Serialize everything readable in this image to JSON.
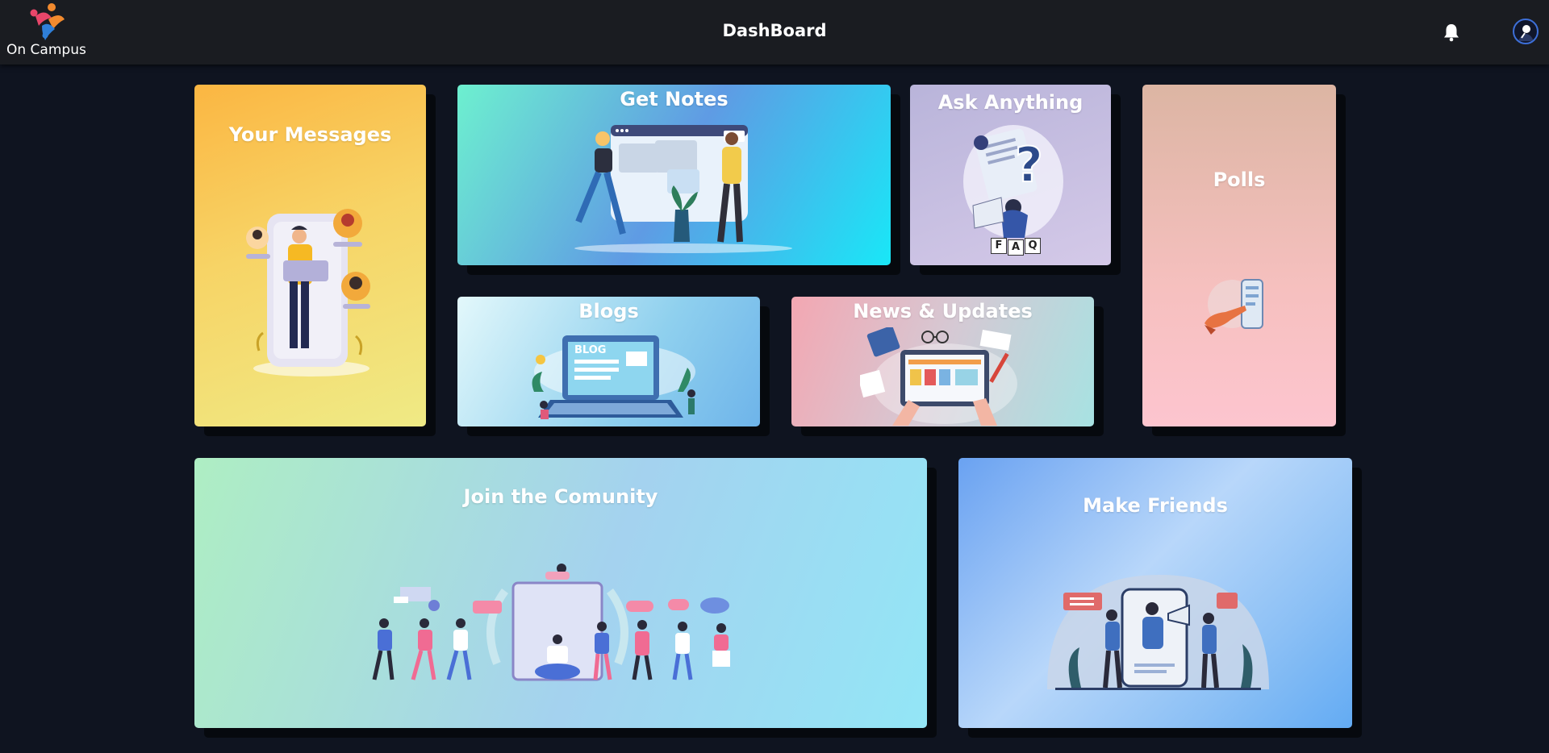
{
  "app": {
    "name": "On Campus"
  },
  "header": {
    "title": "DashBoard"
  },
  "cards": {
    "messages": {
      "title": "Your Messages"
    },
    "notes": {
      "title": "Get Notes"
    },
    "ask": {
      "title": "Ask Anything",
      "faq_letters": [
        "F",
        "A",
        "Q"
      ]
    },
    "polls": {
      "title": "Polls"
    },
    "blogs": {
      "title": "Blogs",
      "screen_label": "BLOG"
    },
    "news": {
      "title": "News & Updates"
    },
    "community": {
      "title": "Join the Comunity"
    },
    "friends": {
      "title": "Make Friends"
    }
  },
  "icons": {
    "bell": "bell-icon",
    "avatar": "user-avatar-icon",
    "logo": "on-campus-logo"
  },
  "colors": {
    "background": "#0f1420",
    "topbar": "#1a1c21",
    "avatar_ring": "#3d6fd8"
  }
}
